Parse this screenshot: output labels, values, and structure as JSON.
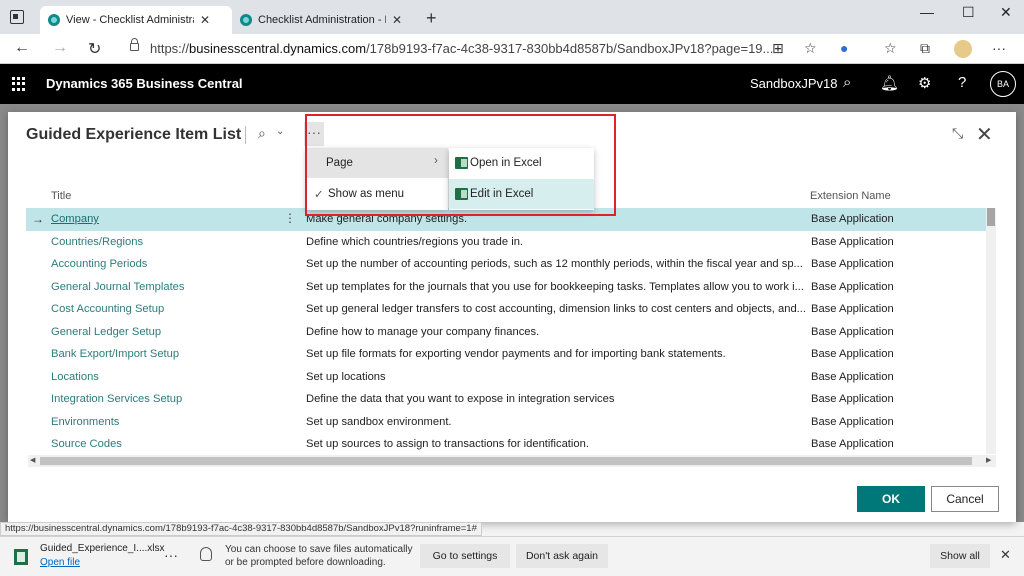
{
  "browser": {
    "tabs": [
      {
        "title": "View - Checklist Administration -"
      },
      {
        "title": "Checklist Administration - Dyna"
      }
    ],
    "url_prefix": "https://",
    "url_host": "businesscentral.dynamics.com",
    "url_path": "/178b9193-f7ac-4c38-9317-830bb4d8587b/SandboxJPv18?page=19...",
    "status_url": "https://businesscentral.dynamics.com/178b9193-f7ac-4c38-9317-830bb4d8587b/SandboxJPv18?runinframe=1#"
  },
  "app": {
    "title": "Dynamics 365 Business Central",
    "company": "SandboxJPv18",
    "avatar": "BA"
  },
  "dialog": {
    "title": "Guided Experience Item List",
    "more_label": "···",
    "columns": {
      "title": "Title",
      "description": "",
      "extension": "Extension Name"
    },
    "rows": [
      {
        "title": "Company",
        "description": "Make general company settings.",
        "extension": "Base Application"
      },
      {
        "title": "Countries/Regions",
        "description": "Define which countries/regions you trade in.",
        "extension": "Base Application"
      },
      {
        "title": "Accounting Periods",
        "description": "Set up the number of accounting periods, such as 12 monthly periods, within the fiscal year and sp...",
        "extension": "Base Application"
      },
      {
        "title": "General Journal Templates",
        "description": "Set up templates for the journals that you use for bookkeeping tasks. Templates allow you to work i...",
        "extension": "Base Application"
      },
      {
        "title": "Cost Accounting Setup",
        "description": "Set up general ledger transfers to cost accounting, dimension links to cost centers and objects, and...",
        "extension": "Base Application"
      },
      {
        "title": "General Ledger Setup",
        "description": "Define how to manage your company finances.",
        "extension": "Base Application"
      },
      {
        "title": "Bank Export/Import Setup",
        "description": "Set up file formats for exporting vendor payments and for importing bank statements.",
        "extension": "Base Application"
      },
      {
        "title": "Locations",
        "description": "Set up locations",
        "extension": "Base Application"
      },
      {
        "title": "Integration Services Setup",
        "description": "Define the data that you want to expose in integration services",
        "extension": "Base Application"
      },
      {
        "title": "Environments",
        "description": "Set up sandbox environment.",
        "extension": "Base Application"
      },
      {
        "title": "Source Codes",
        "description": "Set up sources to assign to transactions for identification.",
        "extension": "Base Application"
      }
    ],
    "ok_label": "OK",
    "cancel_label": "Cancel"
  },
  "menu": {
    "page_label": "Page",
    "show_as_menu_label": "Show as menu",
    "open_in_excel_label": "Open in Excel",
    "edit_in_excel_label": "Edit in Excel"
  },
  "download": {
    "file_name": "Guided_Experience_I....xlsx",
    "open_file_label": "Open file",
    "message_line1": "You can choose to save files automatically",
    "message_line2": "or be prompted before downloading.",
    "go_to_settings_label": "Go to settings",
    "dont_ask_label": "Don't ask again",
    "show_all_label": "Show all"
  }
}
